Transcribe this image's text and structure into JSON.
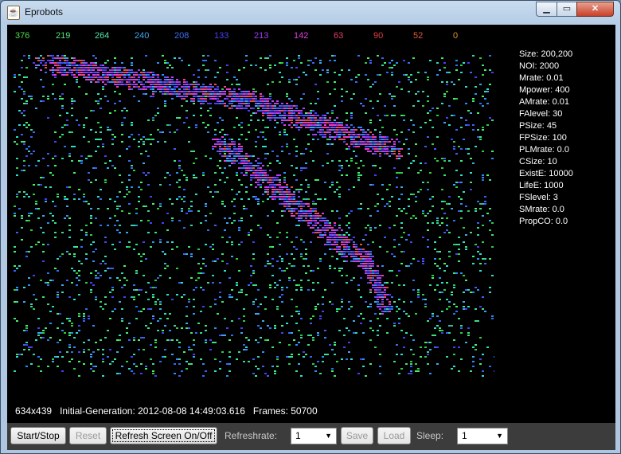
{
  "window": {
    "title": "Eprobots",
    "app_icon": "java-cup-icon"
  },
  "caption_buttons": {
    "minimize": "minimize-icon",
    "maximize": "maximize-icon",
    "close": "close-icon"
  },
  "population_counts": [
    {
      "value": "376",
      "color": "#4ddc4d"
    },
    {
      "value": "219",
      "color": "#52e67a"
    },
    {
      "value": "264",
      "color": "#4fe6a8"
    },
    {
      "value": "240",
      "color": "#3fa6ee"
    },
    {
      "value": "208",
      "color": "#3f6ff0"
    },
    {
      "value": "133",
      "color": "#4a3ff0"
    },
    {
      "value": "213",
      "color": "#9a3ff0"
    },
    {
      "value": "142",
      "color": "#e23fe0"
    },
    {
      "value": "63",
      "color": "#e23f6a"
    },
    {
      "value": "90",
      "color": "#e23f3f"
    },
    {
      "value": "52",
      "color": "#e05a3a"
    },
    {
      "value": "0",
      "color": "#e0923a"
    }
  ],
  "parameters": [
    "Size: 200,200",
    "NOI: 2000",
    "Mrate: 0.01",
    "Mpower: 400",
    "AMrate: 0.01",
    "FAlevel: 30",
    "PSize: 45",
    "FPSize: 100",
    "PLMrate: 0.0",
    "CSize: 10",
    "ExistE: 10000",
    "LifeE: 1000",
    "FSlevel: 3",
    "SMrate: 0.0",
    "PropCO: 0.0"
  ],
  "status": {
    "resolution": "634x439",
    "initial_generation": "Initial-Generation: 2012-08-08 14:49:03.616",
    "frames": "Frames: 50700"
  },
  "controls": {
    "start_stop": "Start/Stop",
    "reset": "Reset",
    "refresh_toggle": "Refresh Screen On/Off",
    "refreshrate_label": "Refreshrate:",
    "refreshrate_value": "1",
    "save": "Save",
    "load": "Load",
    "sleep_label": "Sleep:",
    "sleep_value": "1"
  }
}
